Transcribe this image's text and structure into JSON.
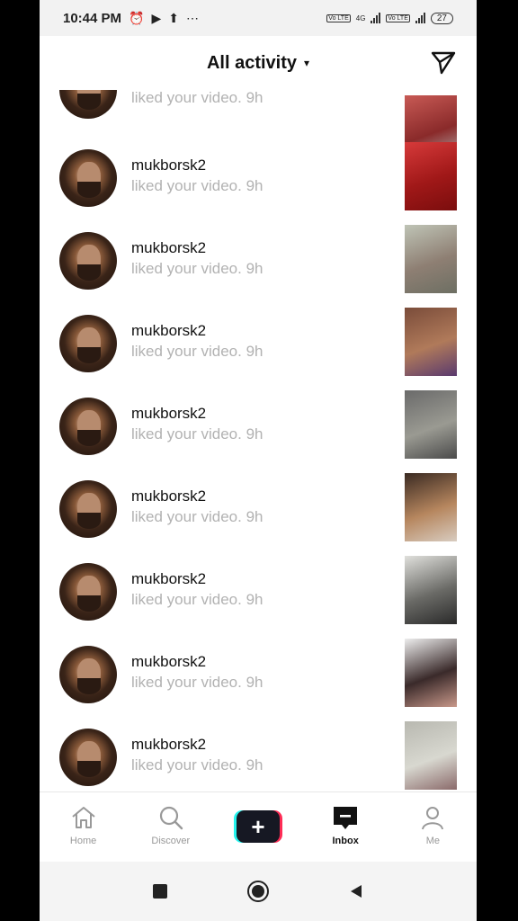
{
  "status_bar": {
    "time": "10:44 PM",
    "icons": [
      "alarm-icon",
      "play-icon",
      "upload-icon",
      "more-icon"
    ],
    "volte1": "Vo LTE",
    "network_type": "4G",
    "volte2": "Vo LTE",
    "battery": "27"
  },
  "header": {
    "title": "All activity",
    "caret": "▾",
    "send_icon": "paper-plane-icon"
  },
  "notifications": [
    {
      "username": "",
      "action": "liked your video. 9h",
      "thumb_colors": [
        "#c85a55",
        "#8a2a2a",
        "#b8b8b8"
      ]
    },
    {
      "username": "mukborsk2",
      "action": "liked your video. 9h",
      "thumb_colors": [
        "#d63a3a",
        "#a01818",
        "#7a0d0d"
      ]
    },
    {
      "username": "mukborsk2",
      "action": "liked your video. 9h",
      "thumb_colors": [
        "#bfc4b6",
        "#8e7f73",
        "#6d6f63"
      ]
    },
    {
      "username": "mukborsk2",
      "action": "liked your video. 9h",
      "thumb_colors": [
        "#7a4c3a",
        "#b07a5a",
        "#5a3a6e"
      ]
    },
    {
      "username": "mukborsk2",
      "action": "liked your video. 9h",
      "thumb_colors": [
        "#6a6a6a",
        "#9a9a92",
        "#4a4a4a"
      ]
    },
    {
      "username": "mukborsk2",
      "action": "liked your video. 9h",
      "thumb_colors": [
        "#3a2a22",
        "#b6865e",
        "#d8ccc0"
      ]
    },
    {
      "username": "mukborsk2",
      "action": "liked your video. 9h",
      "thumb_colors": [
        "#e0e0dc",
        "#6a6a66",
        "#2a2a2a"
      ]
    },
    {
      "username": "mukborsk2",
      "action": "liked your video. 9h",
      "thumb_colors": [
        "#eeeeee",
        "#3a2a2a",
        "#c8988a"
      ]
    },
    {
      "username": "mukborsk2",
      "action": "liked your video. 9h",
      "thumb_colors": [
        "#b8b8b0",
        "#d8d8d0",
        "#8a6a6a"
      ]
    }
  ],
  "bottom_nav": {
    "home": "Home",
    "discover": "Discover",
    "create": "+",
    "inbox": "Inbox",
    "me": "Me"
  },
  "colors": {
    "create_cyan": "#25f4ee",
    "create_red": "#fe2c55",
    "create_dark": "#161823",
    "secondary_text": "#b2b2b2"
  },
  "system_nav": [
    "recents-square-icon",
    "home-circle-icon",
    "back-triangle-icon"
  ]
}
